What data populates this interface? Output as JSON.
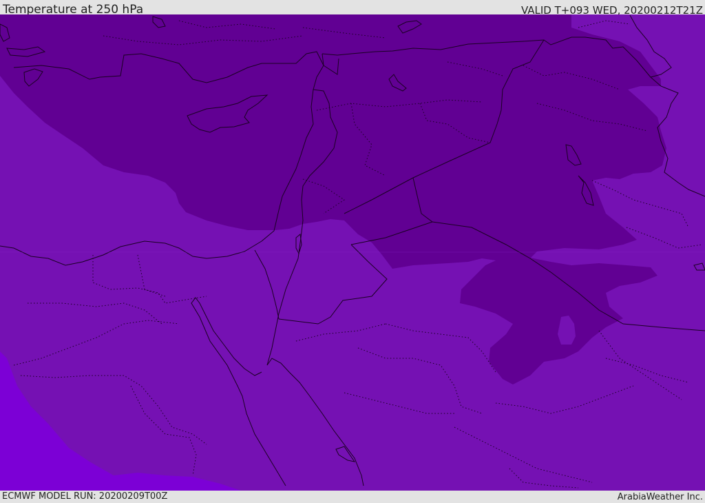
{
  "header": {
    "title": "Temperature at 250 hPa",
    "valid": "VALID T+093 WED, 20200212T21Z"
  },
  "footer": {
    "model_run": "ECMWF MODEL RUN: 20200209T00Z",
    "credit": "ArabiaWeather Inc."
  },
  "colors": {
    "darkest_band": "#610093",
    "mid_band": "#7511b3",
    "light_band": "#7c00d6",
    "borders": "#1a0022",
    "bar_background": "#e3e3e3"
  },
  "map": {
    "variable": "Temperature",
    "level": "250 hPa"
  }
}
